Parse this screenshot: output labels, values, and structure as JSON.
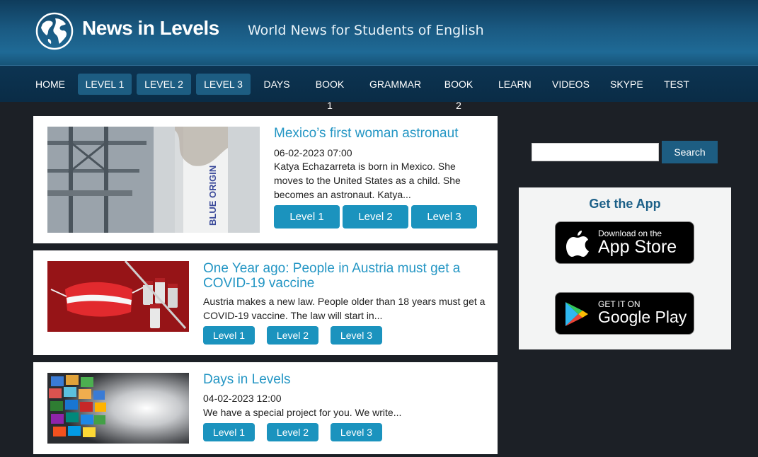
{
  "header": {
    "logo_text": "News in Levels",
    "tagline": "World News for Students of English"
  },
  "nav": {
    "items": [
      "HOME",
      "LEVEL 1",
      "LEVEL 2",
      "LEVEL 3",
      "DAYS",
      "BOOK 1",
      "GRAMMAR",
      "BOOK 2",
      "LEARN",
      "VIDEOS",
      "SKYPE",
      "TEST"
    ]
  },
  "articles": [
    {
      "title": "Mexico’s first woman astronaut",
      "date": "06-02-2023 07:00",
      "excerpt": "Katya Echazarreta is born in Mexico. She moves to the United States as a child. She becomes an astronaut. Katya...",
      "thumb_text": "BLUE ORIGIN",
      "levels": [
        "Level 1",
        "Level 2",
        "Level 3"
      ]
    },
    {
      "title": "One Year ago: People in Austria must get a COVID-19 vaccine",
      "date": "",
      "excerpt": "Austria makes a new law. People older than 18 years must get a COVID-19 vaccine. The law will start in...",
      "levels": [
        "Level 1",
        "Level 2",
        "Level 3"
      ]
    },
    {
      "title": "Days in Levels",
      "date": "04-02-2023 12:00",
      "excerpt": "We have a special project for you. We write...",
      "levels": [
        "Level 1",
        "Level 2",
        "Level 3"
      ]
    }
  ],
  "sidebar": {
    "search_button": "Search",
    "app_title": "Get the App",
    "app_store": {
      "small": "Download on the",
      "big": "App Store"
    },
    "google_play": {
      "small": "GET IT ON",
      "big": "Google Play"
    }
  },
  "colors": {
    "accent": "#2496c4",
    "button": "#1b93be",
    "nav_active": "#1d5d82",
    "background": "#1c2026"
  }
}
